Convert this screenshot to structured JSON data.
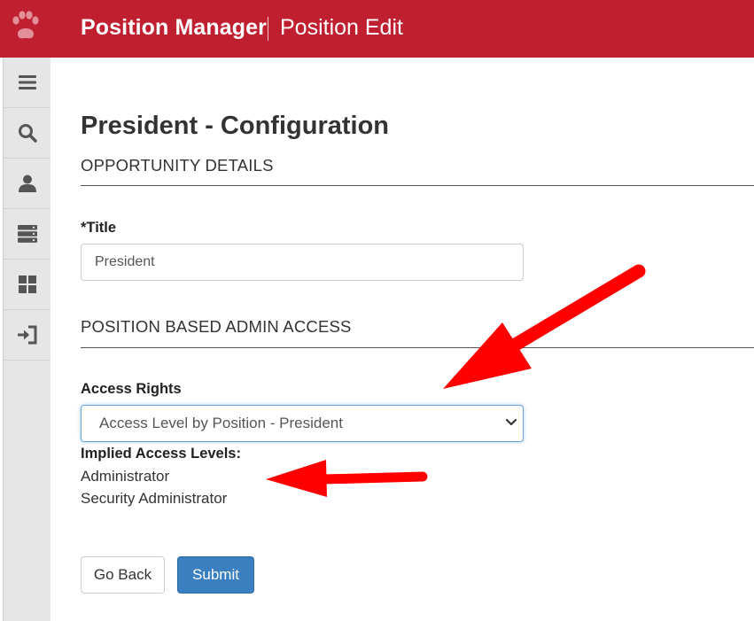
{
  "header": {
    "app_title": "Position Manager",
    "page_title": "Position Edit",
    "brand_color": "#c01f30",
    "logo_icon": "paw-print-icon"
  },
  "sidebar": {
    "items": [
      {
        "icon": "menu-icon"
      },
      {
        "icon": "search-icon"
      },
      {
        "icon": "user-icon"
      },
      {
        "icon": "server-icon"
      },
      {
        "icon": "grid-icon"
      },
      {
        "icon": "sign-in-icon"
      }
    ]
  },
  "main": {
    "heading": "President - Configuration",
    "sections": {
      "opportunity": "OPPORTUNITY DETAILS",
      "admin_access": "POSITION BASED ADMIN ACCESS"
    },
    "title_field": {
      "label": "*Title",
      "value": "President"
    },
    "access_rights": {
      "label": "Access Rights",
      "selected": "Access Level by Position - President"
    },
    "implied": {
      "label": "Implied Access Levels:",
      "levels": [
        "Administrator",
        "Security Administrator"
      ]
    },
    "buttons": {
      "back": "Go Back",
      "submit": "Submit"
    }
  },
  "annotations": {
    "arrow_color": "#ff0000"
  }
}
